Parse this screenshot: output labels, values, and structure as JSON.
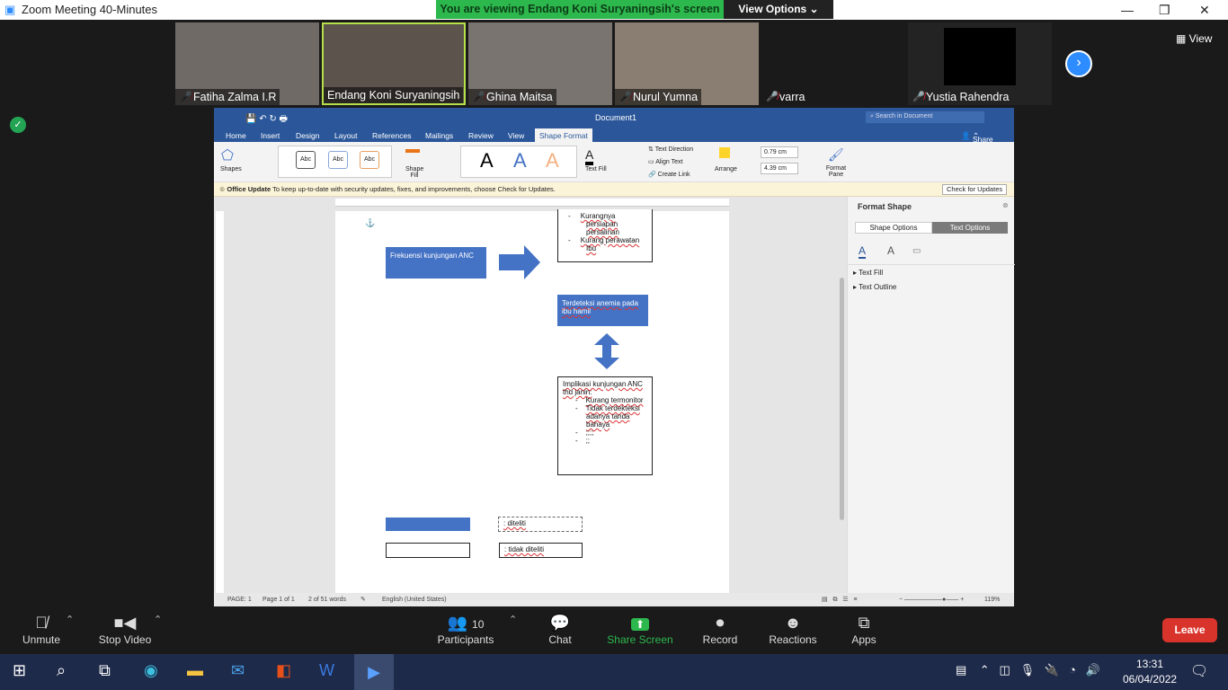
{
  "window": {
    "title": "Zoom Meeting 40-Minutes",
    "banner": "You are viewing Endang Koni Suryaningsih's screen",
    "view_options": "View Options ⌄",
    "view_label": "View"
  },
  "participants": [
    {
      "name": "Fatiha Zalma I.R",
      "muted": true
    },
    {
      "name": "Endang Koni Suryaningsih",
      "muted": false
    },
    {
      "name": "Ghina Maitsa",
      "muted": true
    },
    {
      "name": "Nurul Yumna",
      "muted": true
    },
    {
      "name": "varra",
      "muted": true
    },
    {
      "name": "Yustia Rahendra",
      "muted": true
    }
  ],
  "word": {
    "doc_title": "Document1",
    "search_placeholder": "Search in Document",
    "share": "Share",
    "tabs": [
      "Home",
      "Insert",
      "Design",
      "Layout",
      "References",
      "Mailings",
      "Review",
      "View",
      "Shape Format"
    ],
    "active_tab": "Shape Format",
    "ribbon": {
      "shapes": "Shapes",
      "style_abc": "Abc",
      "shape_fill": "Shape Fill",
      "text_fill": "Text Fill",
      "text_direction": "Text Direction",
      "align_text": "Align Text",
      "create_link": "Create Link",
      "arrange": "Arrange",
      "height": "0.79 cm",
      "width": "4.39 cm",
      "format_pane": "Format Pane"
    },
    "update": {
      "title": "Office Update",
      "message": "To keep up-to-date with security updates, fixes, and improvements, choose Check for Updates.",
      "button": "Check for Updates"
    },
    "doc": {
      "box1": "Frekuensi kunjungan ANC",
      "list_top": [
        "Kurangnya persiapan persalinan",
        "Kurang perawatan Ibu"
      ],
      "box2": "Terdeteksi anemia pada ibu hamil",
      "box3_title": "Implikasi kunjungan ANC thd janin:",
      "box3_items": [
        "Kurang termonitor",
        "Tidak terdekteksi adanya tanda bahaya",
        ";;;;",
        ";;"
      ],
      "legend1": ": diteliti",
      "legend2": ": tidak diteliti"
    },
    "pane": {
      "title": "Format Shape",
      "tab1": "Shape Options",
      "tab2": "Text Options",
      "sec1": "Text Fill",
      "sec2": "Text Outline"
    },
    "status": {
      "page": "PAGE: 1",
      "pages": "Page 1 of 1",
      "words": "2 of 51 words",
      "lang": "English (United States)",
      "zoom": "119%"
    }
  },
  "toolbar": {
    "unmute": "Unmute",
    "stop_video": "Stop Video",
    "participants": "Participants",
    "participant_count": "10",
    "chat": "Chat",
    "share": "Share Screen",
    "record": "Record",
    "reactions": "Reactions",
    "apps": "Apps",
    "leave": "Leave"
  },
  "taskbar": {
    "time": "13:31",
    "date": "06/04/2022"
  },
  "colors": {
    "word_blue": "#2b579a",
    "share_green": "#2db84d",
    "leave_red": "#d9342b",
    "shape_blue": "#4472c4"
  }
}
